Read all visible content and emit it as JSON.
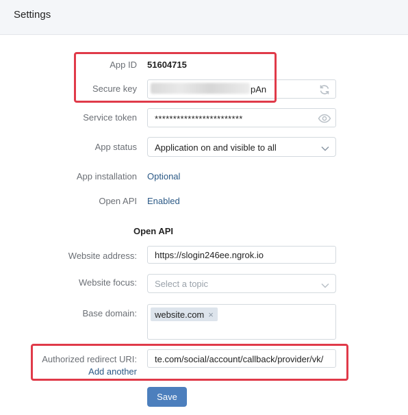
{
  "header": {
    "title": "Settings"
  },
  "fields": {
    "app_id": {
      "label": "App ID",
      "value": "51604715"
    },
    "secure_key": {
      "label": "Secure key",
      "value_suffix": "pAn",
      "refresh_icon": "refresh-icon"
    },
    "service_token": {
      "label": "Service token",
      "value": "************************",
      "reveal_icon": "eye-icon"
    },
    "app_status": {
      "label": "App status",
      "value": "Application on and visible to all"
    },
    "app_installation": {
      "label": "App installation",
      "value": "Optional"
    },
    "open_api": {
      "label": "Open API",
      "value": "Enabled"
    }
  },
  "open_api_section": {
    "title": "Open API",
    "website_address": {
      "label": "Website address:",
      "value": "https://slogin246ee.ngrok.io"
    },
    "website_focus": {
      "label": "Website focus:",
      "placeholder": "Select a topic"
    },
    "base_domain": {
      "label": "Base domain:",
      "tags": [
        "website.com"
      ],
      "remove_symbol": "×"
    },
    "redirect_uri": {
      "label": "Authorized redirect URI:",
      "value": "te.com/social/account/callback/provider/vk/",
      "add_another": "Add another"
    }
  },
  "actions": {
    "save_label": "Save"
  },
  "colors": {
    "highlight": "#e03a49",
    "accent": "#4c7fbd",
    "link": "#2a5885"
  }
}
